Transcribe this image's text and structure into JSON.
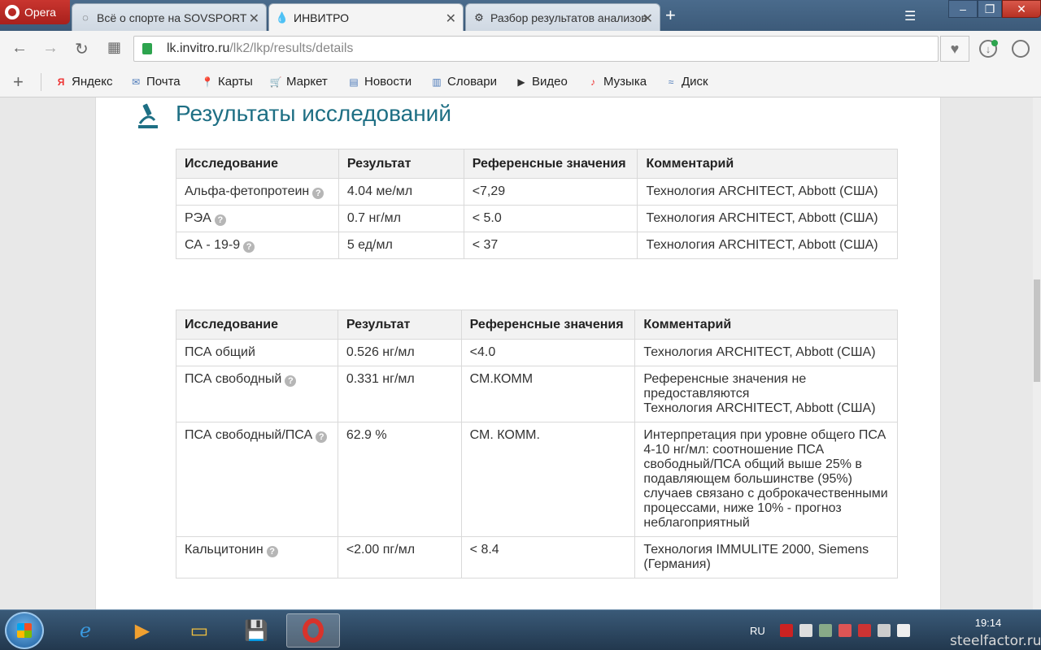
{
  "browser": {
    "opera_label": "Opera",
    "tabs": [
      {
        "title": "Всё о спорте на SOVSPORT",
        "active": false
      },
      {
        "title": "ИНВИТРО",
        "active": true
      },
      {
        "title": "Разбор результатов анализов",
        "active": false
      }
    ],
    "url_host": "lk.invitro.ru",
    "url_path": "/lk2/lkp/results/details"
  },
  "bookmarks": [
    "Яндекс",
    "Почта",
    "Карты",
    "Маркет",
    "Новости",
    "Словари",
    "Видео",
    "Музыка",
    "Диск"
  ],
  "page": {
    "title": "Результаты исследований",
    "table1": {
      "headers": [
        "Исследование",
        "Результат",
        "Референсные значения",
        "Комментарий"
      ],
      "rows": [
        {
          "name": "Альфа-фетопротеин",
          "result": "4.04 ме/мл",
          "ref": "<7,29",
          "comment": "Технология ARCHITECT, Abbott (США)"
        },
        {
          "name": "РЭА",
          "result": "0.7 нг/мл",
          "ref": "< 5.0",
          "comment": "Технология ARCHITECT, Abbott (США)"
        },
        {
          "name": "СА - 19-9",
          "result": "5 ед/мл",
          "ref": "< 37",
          "comment": "Технология ARCHITECT, Abbott (США)"
        }
      ]
    },
    "table2": {
      "headers": [
        "Исследование",
        "Результат",
        "Референсные значения",
        "Комментарий"
      ],
      "rows": [
        {
          "name": "ПСА общий",
          "result": "0.526 нг/мл",
          "ref": "<4.0",
          "comment": "Технология ARCHITECT, Abbott (США)"
        },
        {
          "name": "ПСА свободный",
          "result": "0.331 нг/мл",
          "ref": "СМ.КОММ",
          "comment": "Референсные значения не предоставляются\nТехнология ARCHITECT, Abbott (США)"
        },
        {
          "name": "ПСА свободный/ПСА",
          "result": "62.9 %",
          "ref": "СМ. КОММ.",
          "comment": "Интерпретация при уровне общего ПСА 4-10 нг/мл: соотношение ПСА свободный/ПСА общий выше 25% в подавляющем большинстве (95%) случаев связано с доброкачественными процессами, ниже 10% - прогноз неблагоприятный"
        },
        {
          "name": "Кальцитонин",
          "result": "<2.00 пг/мл",
          "ref": "< 8.4",
          "comment": "Технология IMMULITE 2000, Siemens (Германия)"
        }
      ]
    }
  },
  "taskbar": {
    "lang": "RU",
    "time": "19:14",
    "watermark": "steelfactor.ru"
  },
  "colors": {
    "title": "#1e6f84",
    "opera_red": "#c9352f",
    "header_bg": "#f2f2f2"
  }
}
